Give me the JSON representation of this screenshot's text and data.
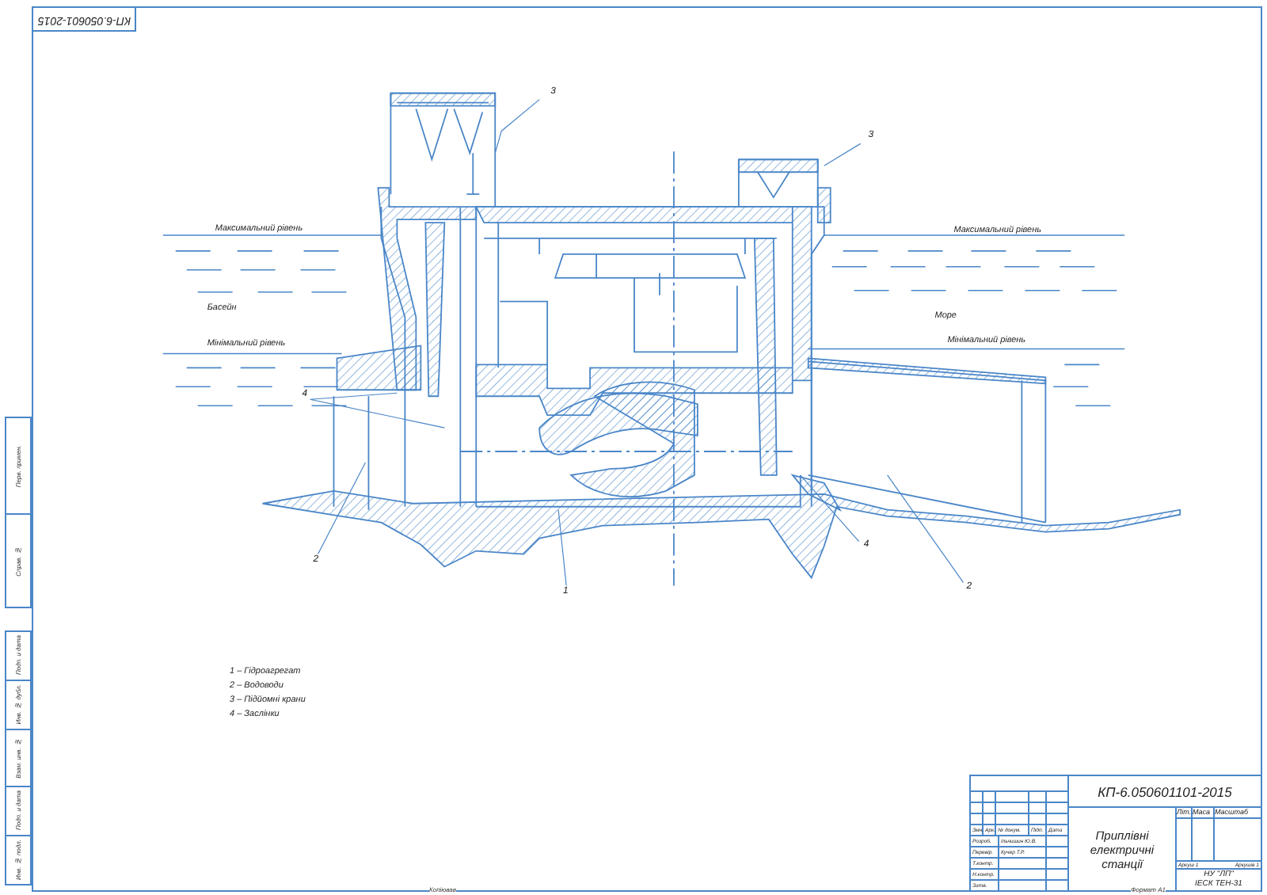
{
  "corner_stamp": "КП-6.050601-2015",
  "margin_stamps": [
    {
      "text": "Перв. примен."
    },
    {
      "text": "Справ. №"
    },
    {
      "text": "Подп. и дата"
    },
    {
      "text": "Инв. № дубл."
    },
    {
      "text": "Взам. инв. №"
    },
    {
      "text": "Подп. и дата"
    },
    {
      "text": "Инв. № подл."
    }
  ],
  "water_labels": [
    "Максимальний рівень",
    "Басейн",
    "Мінімальний рівень",
    "Максимальний рівень",
    "Море",
    "Мінімальний рівень"
  ],
  "callouts": [
    "3",
    "3",
    "4",
    "2",
    "1",
    "4",
    "2"
  ],
  "legend": [
    "1 – Гідроагрегат",
    "2 – Водоводи",
    "3 – Підйомні крани",
    "4 – Заслінки"
  ],
  "title_block": {
    "code": "КП-6.050601101-2015",
    "title": "Приплівні електричні станції",
    "header_cells": [
      "Змн.",
      "Арк.",
      "№ докум.",
      "Підп.",
      "Дата"
    ],
    "roles": [
      {
        "role": "Розроб.",
        "name": "Ільчишин Ю.В."
      },
      {
        "role": "Перевір.",
        "name": "Кучер Т.Р."
      },
      {
        "role": "Т.контр."
      },
      {
        "role": "Н.контр."
      },
      {
        "role": "Затв."
      }
    ],
    "info_headers": [
      "Літ.",
      "Маса",
      "Масштаб"
    ],
    "sheet": "Аркуш 1",
    "sheets": "Аркушів 1",
    "org": [
      "НУ \"ЛП\"",
      "ІЕСК ТЕН-31"
    ],
    "copied": "Копіював",
    "format": "Формат А1"
  }
}
